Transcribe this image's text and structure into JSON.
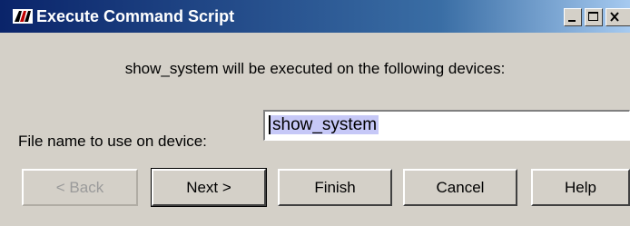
{
  "window": {
    "title": "Execute Command Script",
    "app_icon": "app-logo-icon",
    "controls": {
      "minimize_icon": "minimize-icon",
      "maximize_icon": "maximize-icon",
      "close_icon": "close-icon"
    }
  },
  "message": "show_system will be executed on the following devices:",
  "file_field": {
    "label": "File name to use on device:",
    "value": "show_system",
    "selected": true
  },
  "buttons": {
    "back": "< Back",
    "next": "Next >",
    "finish": "Finish",
    "cancel": "Cancel",
    "help": "Help"
  },
  "colors": {
    "titlebar_start": "#0a246a",
    "titlebar_end": "#a6caf0",
    "dialog_bg": "#d4d0c8",
    "selection_bg": "#c6c8f7"
  }
}
